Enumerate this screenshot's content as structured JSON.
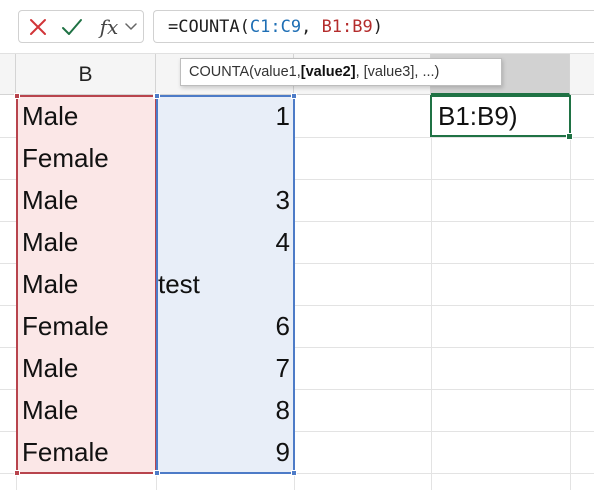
{
  "formula_bar": {
    "cancel_icon": "x-icon",
    "cancel_color": "#d13438",
    "enter_icon": "check-icon",
    "enter_color": "#1f7244",
    "fx_label": "fx",
    "dropdown_icon": "chevron-down-icon",
    "formula_parts": [
      {
        "text": "=COUNTA(",
        "color": "#1f1f1f"
      },
      {
        "text": "C1:C9",
        "color": "#1f6fb5"
      },
      {
        "text": ", ",
        "color": "#1f1f1f"
      },
      {
        "text": "B1:B9",
        "color": "#b42c2c"
      },
      {
        "text": ")",
        "color": "#1f1f1f"
      }
    ]
  },
  "columns": {
    "b_header": "B"
  },
  "tooltip": {
    "fn_open": "COUNTA(",
    "arg1": "value1, ",
    "arg2_bold": "[value2]",
    "rest": ", [value3], ...)"
  },
  "rows": [
    {
      "b": "Male",
      "c": "1"
    },
    {
      "b": "Female",
      "c": ""
    },
    {
      "b": "Male",
      "c": "3"
    },
    {
      "b": "Male",
      "c": "4"
    },
    {
      "b": "Male",
      "c": "test"
    },
    {
      "b": "Female",
      "c": "6"
    },
    {
      "b": "Male",
      "c": "7"
    },
    {
      "b": "Male",
      "c": "8"
    },
    {
      "b": "Female",
      "c": "9"
    }
  ],
  "active_cell": {
    "text": "B1:B9)"
  },
  "colors": {
    "range_b_border": "#b8444d",
    "range_b_fill": "#fbe7e7",
    "range_c_border": "#4d7bc7",
    "range_c_fill": "#e8eef8",
    "active_border": "#1f7244"
  }
}
